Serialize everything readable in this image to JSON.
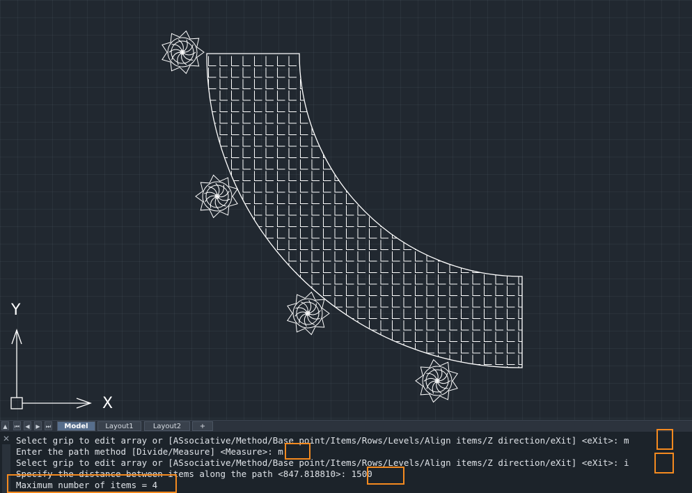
{
  "viewport": {
    "ucs_icon": {
      "x_label": "X",
      "y_label": "Y"
    }
  },
  "tabs": {
    "nav_buttons": [
      {
        "name": "tabs-menu-icon",
        "glyph": "▲"
      },
      {
        "name": "first-tab-icon",
        "glyph": "⏮"
      },
      {
        "name": "prev-tab-icon",
        "glyph": "◀"
      },
      {
        "name": "next-tab-icon",
        "glyph": "▶"
      },
      {
        "name": "last-tab-icon",
        "glyph": "⏭"
      }
    ],
    "model_label": "Model",
    "layout1_label": "Layout1",
    "layout2_label": "Layout2",
    "add_label": "+"
  },
  "command_history": {
    "close_glyph": "✕",
    "lines": [
      "Select grip to edit array or [ASsociative/Method/Base point/Items/Rows/Levels/Align items/Z direction/eXit] <eXit>: m",
      "Enter the path method [Divide/Measure] <Measure>: m",
      "Select grip to edit array or [ASsociative/Method/Base point/Items/Rows/Levels/Align items/Z direction/eXit] <eXit>: i",
      "Specify the distance between items along the path <847.818810>: 1500",
      "Maximum number of items = 4"
    ]
  },
  "colors": {
    "viewport_bg": "#212830",
    "drawing_lines": "#ffffff",
    "highlight": "#f58a1f",
    "active_tab": "#576e8c"
  }
}
